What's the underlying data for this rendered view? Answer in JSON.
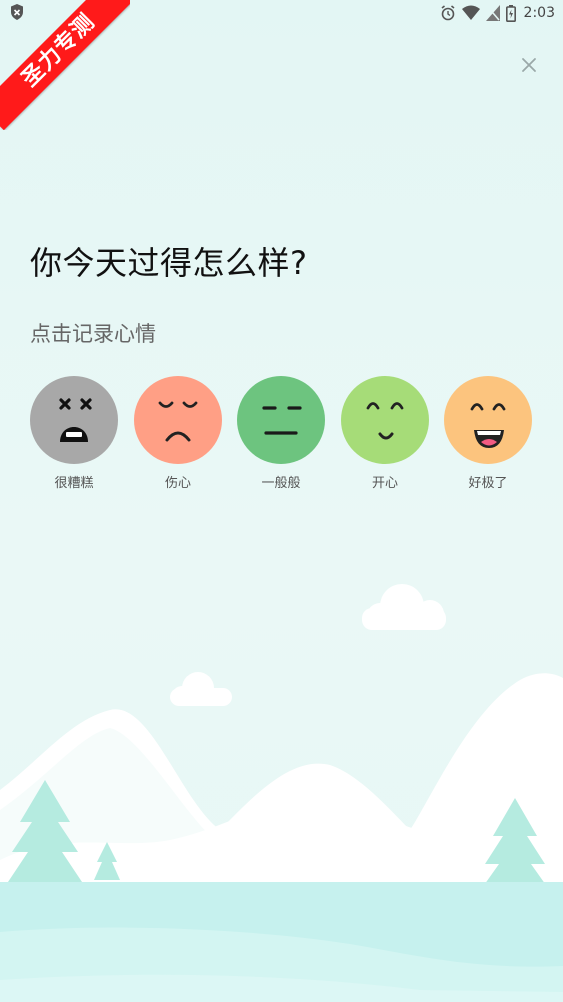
{
  "status_bar": {
    "time": "2:03",
    "icons": [
      "shield-icon",
      "alarm-icon",
      "wifi-icon",
      "no-sim-icon",
      "battery-icon"
    ]
  },
  "ribbon": {
    "text": "圣力专测",
    "color": "#ff1a1a"
  },
  "header": {
    "close_icon": "close-icon"
  },
  "main": {
    "title": "你今天过得怎么样?",
    "subtitle": "点击记录心情",
    "moods": [
      {
        "label": "很糟糕",
        "color": "#a8a8a8",
        "icon": "terrible-face-icon"
      },
      {
        "label": "伤心",
        "color": "#ff9f85",
        "icon": "sad-face-icon"
      },
      {
        "label": "一般般",
        "color": "#6dc47f",
        "icon": "neutral-face-icon"
      },
      {
        "label": "开心",
        "color": "#a6dc78",
        "icon": "happy-face-icon"
      },
      {
        "label": "好极了",
        "color": "#fcc47e",
        "icon": "great-face-icon"
      }
    ]
  },
  "colors": {
    "background": "#e3f6f4",
    "mountain": "#ffffff",
    "tree": "#b5ebe0",
    "ground": "#c6f1ee"
  }
}
